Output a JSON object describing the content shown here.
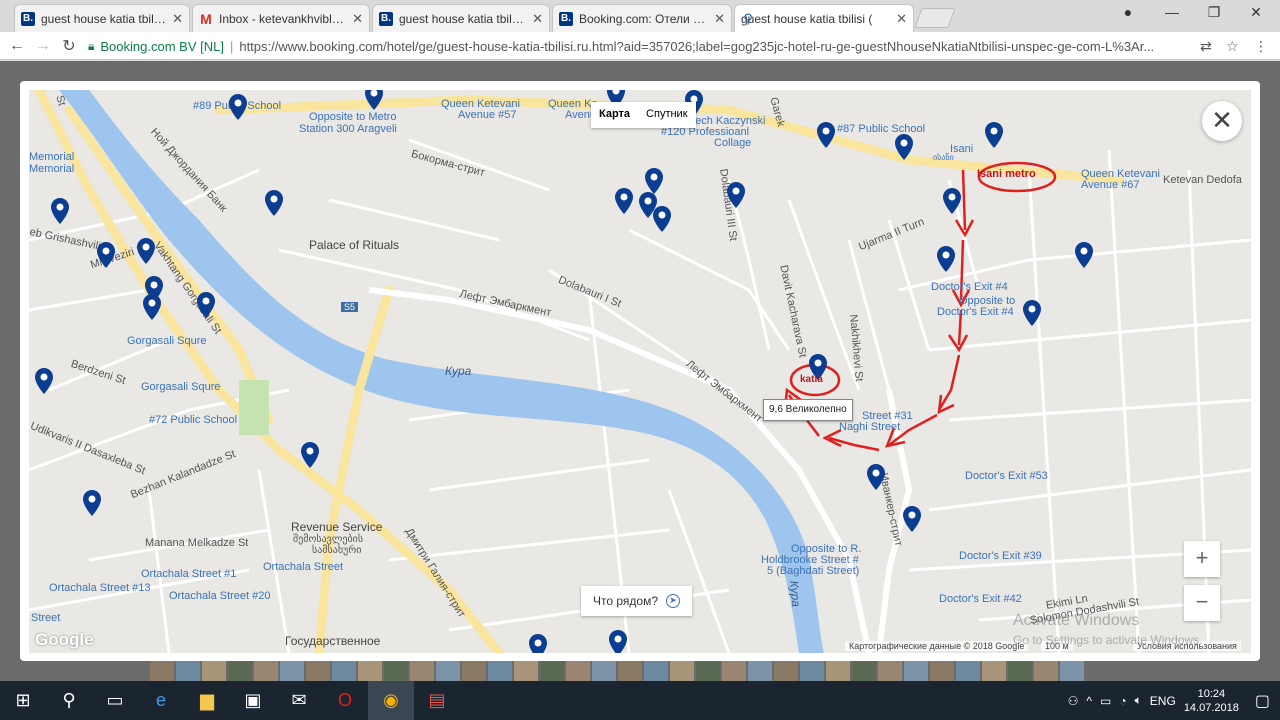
{
  "tabs": [
    {
      "title": "guest house katia tbilisi (",
      "icon": "booking",
      "active": false
    },
    {
      "title": "Inbox - ketevankhvibliani",
      "icon": "gmail",
      "active": false
    },
    {
      "title": "guest house katia tbilisi (",
      "icon": "booking",
      "active": false
    },
    {
      "title": "Booking.com: Отели в Тб",
      "icon": "booking",
      "active": false
    },
    {
      "title": "guest house katia tbilisi (",
      "icon": "map-pin",
      "active": true
    }
  ],
  "tab_close": "✕",
  "favicon_letter": "B.",
  "omnibox": {
    "secure_label": "Booking.com BV [NL]",
    "url": "https://www.booking.com/hotel/ge/guest-house-katia-tbilisi.ru.html?aid=357026;label=gog235jc-hotel-ru-ge-guestNhouseNkatiaNtbilisi-unspec-ge-com-L%3Ar..."
  },
  "map": {
    "type_toggle": {
      "map": "Карта",
      "satellite": "Спутник"
    },
    "close": "✕",
    "zoom_in": "+",
    "zoom_out": "−",
    "nearby": "Что рядом?",
    "hotel_card": "9,6 Великолепно",
    "hotel_label": "katia",
    "metro_label": "Isani metro",
    "river_label": "Кура",
    "river_label2": "Кура",
    "attribution": "Картографические данные © 2018 Google",
    "scale": "100 м",
    "terms": "Условия использования",
    "google": "Google",
    "labels": {
      "school89": "#89 Public School",
      "opposite300": "Opposite to Metro",
      "station300": "Station 300 Aragveli",
      "queen57a": "Queen Ketevani",
      "queen57b": "Avenue #57",
      "queen_short": "Queen Ke",
      "avenue_short": "Avenu",
      "kaczynski": "Lech Kaczynski",
      "school120": "#120 Professioanl",
      "college": "Collage",
      "garek": "Garek",
      "school87": "#87 Public School",
      "isani": "Isani",
      "isani_geo": "ისანი",
      "queen67a": "Queen Ketevani",
      "queen67b": "Avenue #67",
      "ketevan": "Ketevan Dedofa",
      "memorial1": "Memorial",
      "memorial2": "Memorial",
      "grishashvili": "eb Grishashvili St",
      "mirveziri": "Mir Veziri St",
      "nody": "Ной Джордания Банк",
      "vakhtang": "Vakhtang Gorgasali St",
      "bokorma": "Бокорма-стрит",
      "palace": "Palace of Rituals",
      "dolabauri3": "Dolabauri III St",
      "kachar": "Davit Kacharava St",
      "ujarma": "Ujarma II Turn",
      "doctors4a": "Doctor's Exit #4",
      "opposite_to": "Opposite to",
      "doctors4b": "Doctor's Exit #4",
      "dolabauri1": "Dolabauri I St",
      "left_emb": "Лефт Эмбаркмент",
      "left_emb2": "Лефт Эмбаркмент",
      "gorgasali1": "Gorgasali Squre",
      "gorgasali2": "Gorgasali Squre",
      "berdzeni": "Berdzeni St",
      "school72": "#72 Public School",
      "dasaxleba": "Udikvaris II Dasaxleba St",
      "bezhan": "Bezhan Kalandadze St",
      "nakhi": "Nakhikhevi St",
      "street31": "Street #31",
      "baghi": "Naghi Street",
      "doctors53": "Doctor's Exit #53",
      "ivanker": "Иванкер-стрит",
      "revenue": "Revenue Service",
      "revenue_geo": "შემოსავლების",
      "revenue_geo2": "სამსახური",
      "manana": "Manana Melkadze St",
      "ortachala_st": "Ortachala Street",
      "ortachala1": "Ortachala Street #1",
      "ortachala13": "Ortachala Street #13",
      "ortachala20": "Ortachala Street #20",
      "dimitri": "Дмитри Галия-стрит",
      "gosud": "Государственное",
      "holdbrooke1": "Opposite to R.",
      "holdbrooke2": "Holdbrooke Street #",
      "holdbrooke3": "5 (Baghdati Street)",
      "doctors39": "Doctor's Exit #39",
      "doctors42": "Doctor's Exit #42",
      "ekimi": "Ekimi Ln",
      "dadashvili": "Solomon Dodashvili St",
      "street_edge": "Street",
      "s5": "S5",
      "st_short": "St",
      "lesh_st": "St"
    }
  },
  "windows_watermark": {
    "line1": "Activate Windows",
    "line2": "Go to Settings to activate Windows."
  },
  "taskbar": {
    "lang": "ENG",
    "time": "10:24",
    "date": "14.07.2018"
  }
}
